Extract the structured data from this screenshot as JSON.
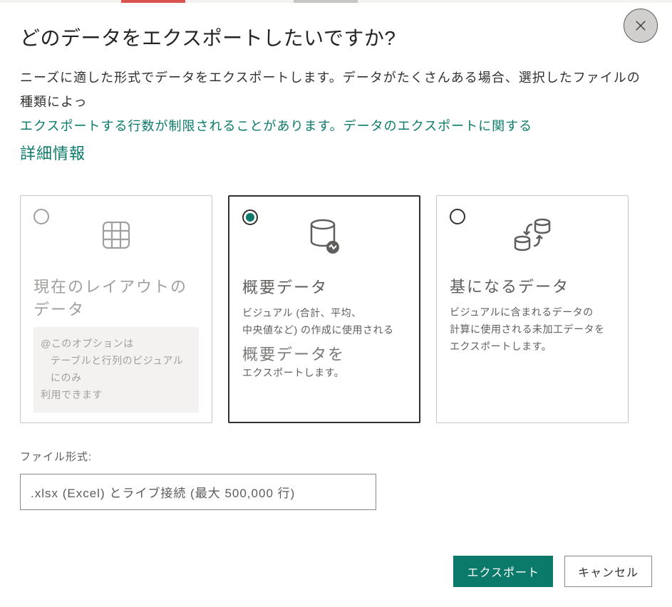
{
  "header": {
    "title": "どのデータをエクスポートしたいですか?"
  },
  "description": {
    "line1_normal": "ニーズに適した形式でデータをエクスポートします。データがたくさんある場合、選択したファイルの種類によっ",
    "line2_link": "エクスポートする行数が制限されることがあります。データのエクスポートに関する",
    "line3_link_bold": "詳細情報"
  },
  "options": [
    {
      "id": "current-layout",
      "title": "現在のレイアウトのデータ",
      "note_line1": "@このオプションは",
      "note_line2": "テーブルと行列のビジュアルにのみ",
      "note_line3": "利用できます",
      "disabled": true,
      "checked": false
    },
    {
      "id": "summary-data",
      "title": "概要データ",
      "text_line1": "ビジュアル (合計、平均、",
      "text_line2": "中央値など) の作成に使用される",
      "mid_title": "概要データを",
      "text_line3": "エクスポートします。",
      "disabled": false,
      "checked": true
    },
    {
      "id": "underlying-data",
      "title": "基になるデータ",
      "text_line1": "ビジュアルに含まれるデータの",
      "text_line2": "計算に使用される未加工データを",
      "text_line3": "エクスポートします。",
      "disabled": false,
      "checked": false
    }
  ],
  "file_format": {
    "label": "ファイル形式:",
    "selected": ".xlsx (Excel) とライブ接続 (最大 500,000 行)"
  },
  "buttons": {
    "export": "エクスポート",
    "cancel": "キャンセル"
  }
}
